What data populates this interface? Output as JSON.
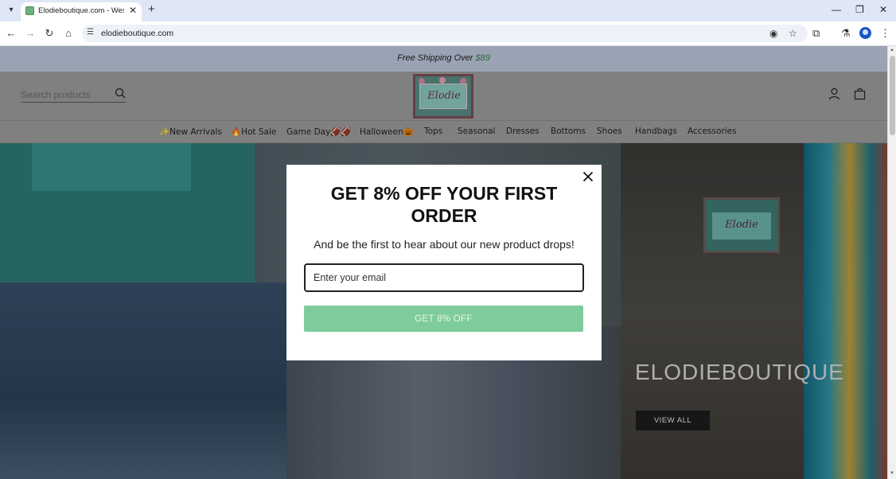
{
  "browser": {
    "tab_title": "Elodieboutique.com - Western",
    "url": "elodieboutique.com",
    "icons": [
      "tab-search-icon",
      "favicon",
      "close-tab-icon",
      "new-tab-icon",
      "minimize-icon",
      "restore-icon",
      "close-window-icon",
      "back-icon",
      "forward-icon",
      "reload-icon",
      "home-icon",
      "site-info-icon",
      "eye-off-icon",
      "star-icon",
      "extensions-icon",
      "labs-icon",
      "profile-icon",
      "menu-icon"
    ]
  },
  "announcement": {
    "text": "Free Shipping Over ",
    "price": "$89"
  },
  "header": {
    "search_placeholder": "Search products",
    "logo_text": "Elodie"
  },
  "nav": {
    "items": [
      "✨New Arrivals",
      "🔥Hot Sale",
      "Game Day🏈🏈",
      "Halloween🎃",
      "Tops",
      "Seasonal",
      "Dresses",
      "Bottoms",
      "Shoes",
      "Handbags",
      "Accessories"
    ]
  },
  "hero": {
    "sign_text": "Elodie",
    "brand": "ELODIEBOUTIQUE",
    "button": "VIEW ALL"
  },
  "modal": {
    "title": "GET 8% OFF YOUR FIRST ORDER",
    "subtitle": "And be the first to hear about our new product drops!",
    "email_placeholder": "Enter your email",
    "submit": "GET 8% OFF"
  },
  "colors": {
    "announcement_bg": "#9aa3b3",
    "submit_bg": "#7ecc9b",
    "price": "#2a6a3f"
  }
}
